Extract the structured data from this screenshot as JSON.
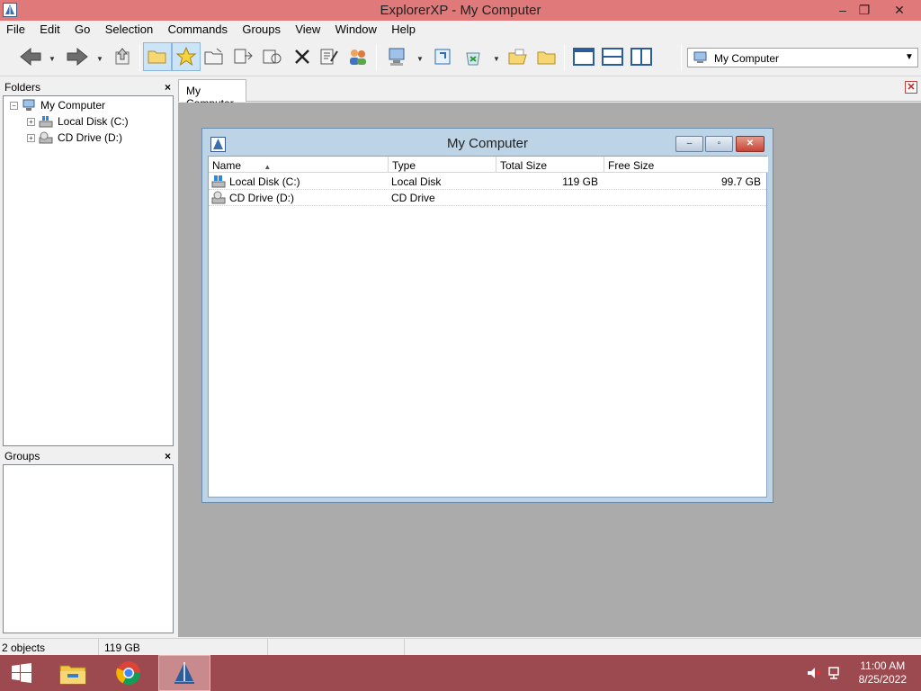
{
  "window": {
    "title": "ExplorerXP - My Computer",
    "minimize": "–",
    "maximize": "❐",
    "close": "✕"
  },
  "menu": [
    "File",
    "Edit",
    "Go",
    "Selection",
    "Commands",
    "Groups",
    "View",
    "Window",
    "Help"
  ],
  "toolbar": {
    "buttons": [
      "back-icon",
      "forward-icon",
      "up-folder-icon",
      "folder-icon",
      "favorites-star-icon",
      "new-folder-icon",
      "copy-to-icon",
      "move-to-icon",
      "delete-icon",
      "properties-icon",
      "users-icon",
      "my-computer-icon",
      "refresh-icon",
      "recycle-icon",
      "open-folder-icon",
      "folder-plain-icon",
      "layout-single-icon",
      "layout-horizontal-icon",
      "layout-vertical-icon"
    ],
    "address": "My Computer"
  },
  "folders_pane": {
    "title": "Folders",
    "close": "×",
    "tree": [
      {
        "label": "My Computer",
        "expander": "−"
      },
      {
        "label": "Local Disk (C:)",
        "expander": "+"
      },
      {
        "label": "CD Drive (D:)",
        "expander": "+"
      }
    ]
  },
  "groups_pane": {
    "title": "Groups",
    "close": "×"
  },
  "tabs": [
    {
      "label": "My Computer"
    }
  ],
  "mdi_close": "✕",
  "child_window": {
    "title": "My Computer",
    "min": "–",
    "max": "▫",
    "close": "✕",
    "columns": [
      "Name",
      "Type",
      "Total Size",
      "Free Size"
    ],
    "sort_indicator": "▲",
    "rows": [
      {
        "name": "Local Disk (C:)",
        "type": "Local Disk",
        "total": "119 GB",
        "free": "99.7 GB"
      },
      {
        "name": "CD Drive (D:)",
        "type": "CD Drive",
        "total": "",
        "free": ""
      }
    ]
  },
  "status": {
    "objects": "2 objects",
    "size": "119 GB"
  },
  "taskbar": {
    "apps": [
      "windows-start-icon",
      "file-explorer-icon",
      "chrome-icon",
      "explorerxp-icon"
    ],
    "time": "11:00 AM",
    "date": "8/25/2022"
  },
  "colors": {
    "title_bar": "#e0797a",
    "taskbar": "#9c4a4f",
    "mdi_background": "#ababab",
    "child_frame": "#bcd4e6"
  }
}
